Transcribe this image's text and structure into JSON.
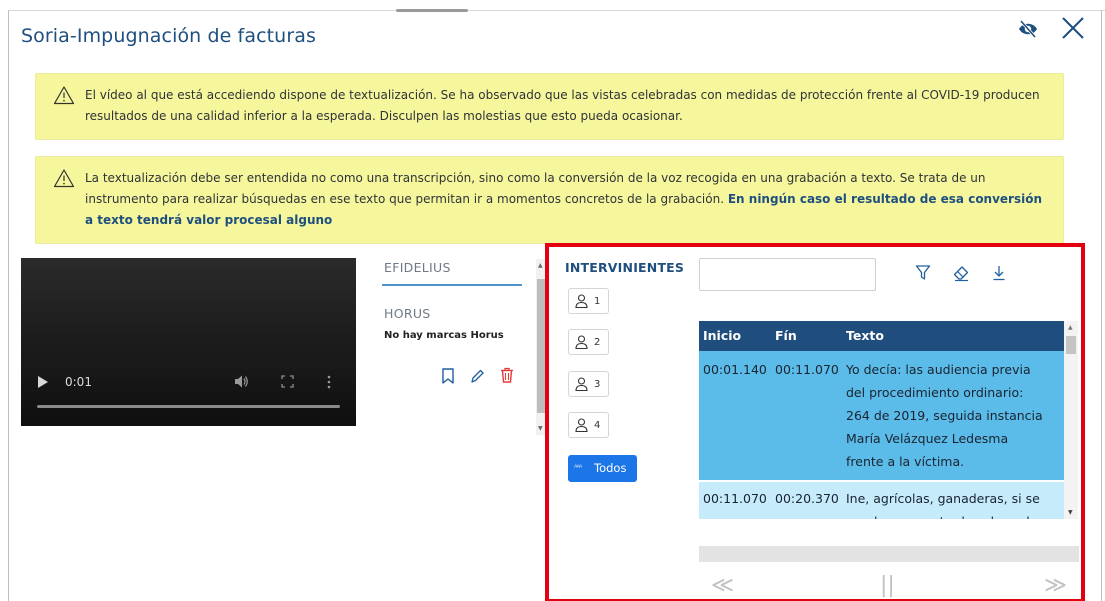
{
  "window": {
    "title": "Soria-Impugnación de facturas"
  },
  "notices": [
    {
      "text": "El vídeo al que está accediendo dispone de textualización. Se ha observado que las vistas celebradas con medidas de protección frente al COVID-19 producen resultados de una calidad inferior a la esperada. Disculpen las molestias que esto pueda ocasionar.",
      "bold": ""
    },
    {
      "text": "La textualización debe ser entendida no como una transcripción, sino como la conversión de la voz recogida en una grabación a texto. Se trata de un instrumento para realizar búsquedas en ese texto que permitan ir a momentos concretos de la grabación.",
      "bold": "En ningún caso el resultado de esa conversión a texto tendrá valor procesal alguno"
    }
  ],
  "video": {
    "time": "0:01"
  },
  "side": {
    "efidelius": "EFIDELIUS",
    "horus": "HORUS",
    "no_marks": "No hay marcas Horus"
  },
  "intervinientes": {
    "title": "INTERVINIENTES",
    "speakers": [
      "1",
      "2",
      "3",
      "4"
    ],
    "all_label": "Todos"
  },
  "search": {
    "value": "",
    "placeholder": ""
  },
  "transcript": {
    "headers": {
      "start": "Inicio",
      "end": "Fín",
      "text": "Texto"
    },
    "rows": [
      {
        "start": "00:01.140",
        "end": "00:11.070",
        "lines": [
          "Yo decía: las audiencia previa",
          "del procedimiento ordinario:",
          "264 de 2019, seguida instancia",
          "María Velázquez Ledesma",
          "frente a la víctima."
        ]
      },
      {
        "start": "00:11.070",
        "end": "00:20.370",
        "lines": [
          "Ine, agrícolas, ganaderas, si se",
          "pueden presentar los abogados"
        ]
      }
    ]
  },
  "icons": {
    "header": [
      "eye-icon",
      "close-icon"
    ],
    "tools": [
      "filter-icon",
      "eraser-icon",
      "download-icon"
    ],
    "marks": [
      "bookmark-icon",
      "pencil-icon",
      "trash-icon"
    ],
    "nav": [
      "prev-icon",
      "pause-icon",
      "next-icon"
    ]
  },
  "colors": {
    "title": "#1f4f7f",
    "notice_bg": "#f6f79c",
    "table_header": "#1f4d7d",
    "row_selected": "#5bbbe9",
    "row_normal": "#c6ebfb",
    "todos_button": "#1c76e8",
    "highlight_frame": "#e3000f"
  }
}
